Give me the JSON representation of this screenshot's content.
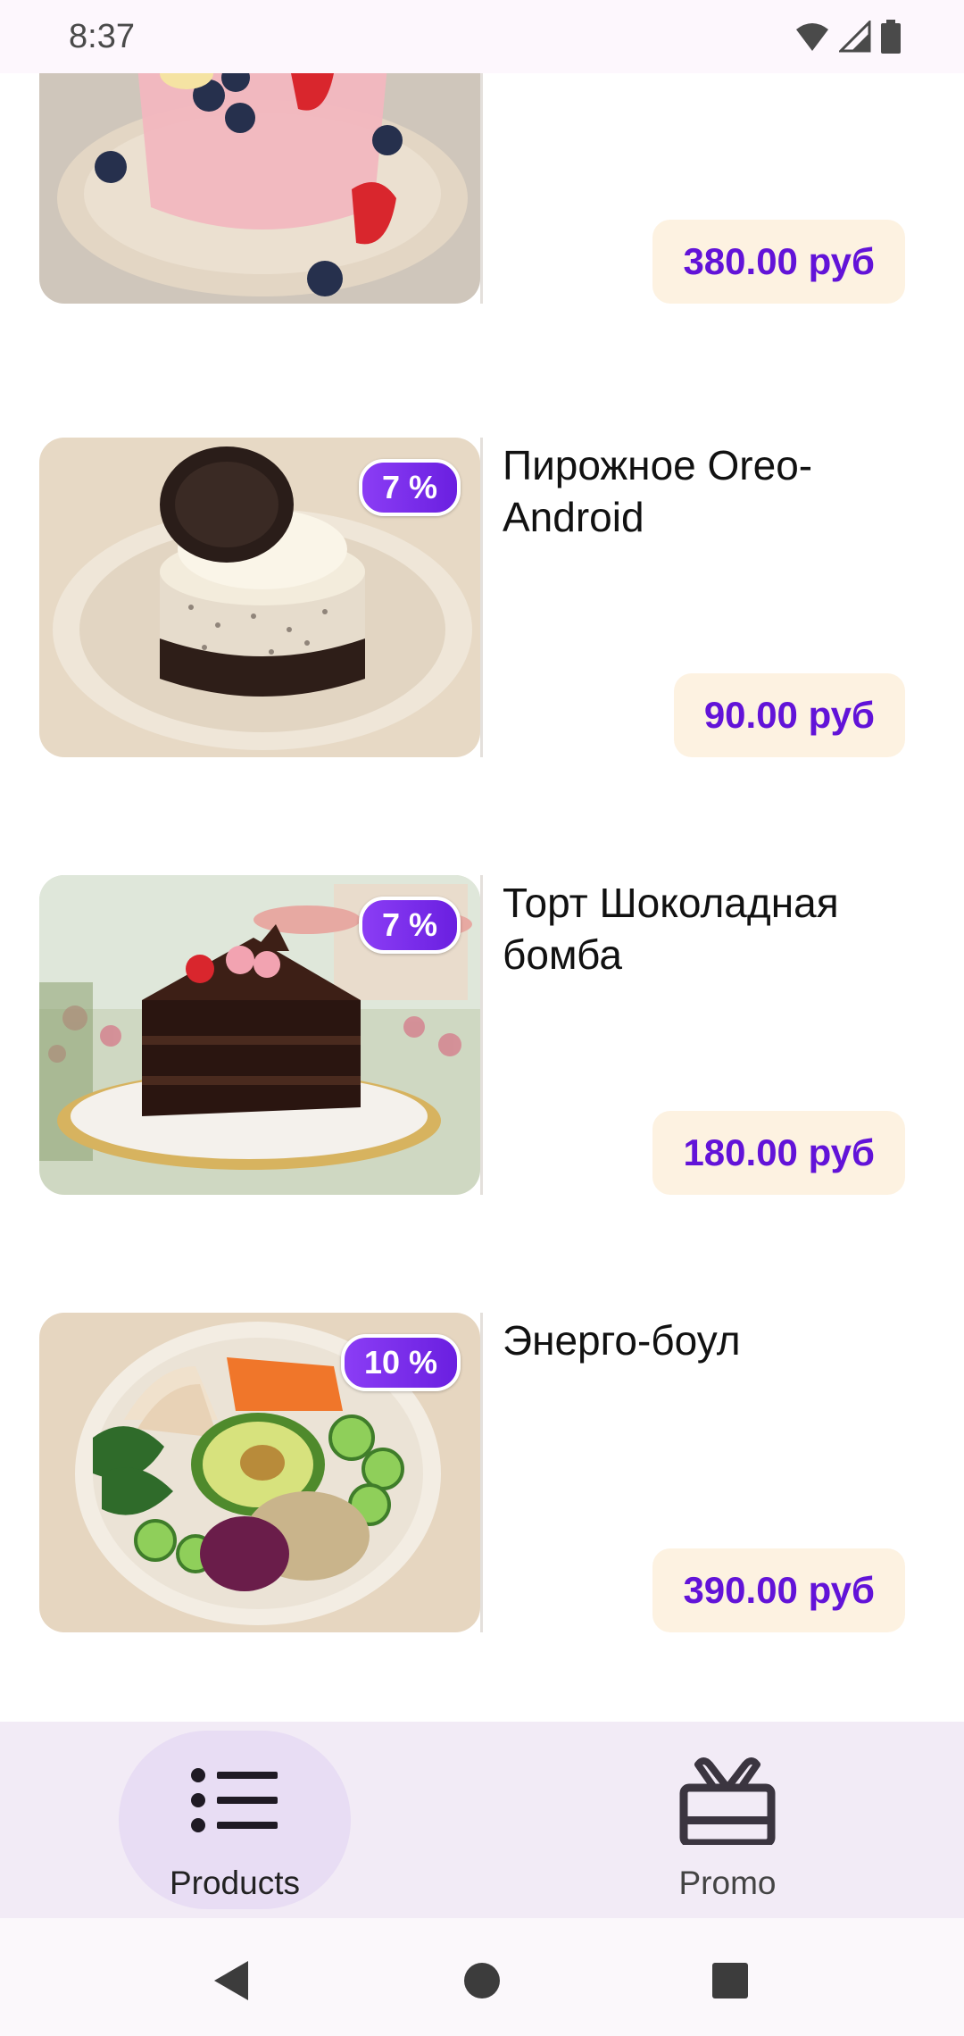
{
  "status_bar": {
    "time": "8:37",
    "icons": [
      "wifi-icon",
      "signal-icon",
      "battery-icon"
    ]
  },
  "products": [
    {
      "title": "",
      "price": "380.00 руб",
      "discount": "",
      "image": "smoothie-image"
    },
    {
      "title": "Пирожное Oreo-Android",
      "price": "90.00 руб",
      "discount": "7 %",
      "image": "oreo-cake-image"
    },
    {
      "title": "Торт Шоколадная бомба",
      "price": "180.00 руб",
      "discount": "7 %",
      "image": "chocolate-cake-image"
    },
    {
      "title": "Энерго-боул",
      "price": "390.00 руб",
      "discount": "10 %",
      "image": "bowl-image"
    }
  ],
  "bottom_nav": {
    "items": [
      {
        "label": "Products",
        "icon": "list-icon",
        "selected": true
      },
      {
        "label": "Promo",
        "icon": "gift-icon",
        "selected": false
      }
    ]
  },
  "system_nav": {
    "buttons": [
      "back-icon",
      "home-icon",
      "recents-icon"
    ]
  },
  "colors": {
    "accent": "#6213d8",
    "badge": "#7b2ff0",
    "price_bg": "#fdf2e1",
    "nav_bg": "#f2ebf6",
    "nav_pill": "#e8ddf4"
  }
}
